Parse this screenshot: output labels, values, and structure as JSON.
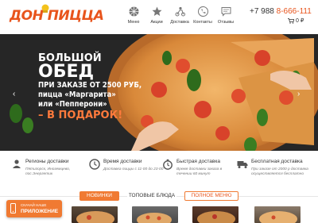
{
  "header": {
    "logo": "ДОН ПИЦЦА",
    "nav": [
      {
        "label": "Меню",
        "icon": "menu-dial-icon"
      },
      {
        "label": "Акции",
        "icon": "star-icon"
      },
      {
        "label": "Доставка",
        "icon": "delivery-icon"
      },
      {
        "label": "Контакты",
        "icon": "phone-icon"
      },
      {
        "label": "Отзывы",
        "icon": "chat-icon"
      }
    ],
    "phone_prefix": "+7 988 ",
    "phone_accent": "8-666-111",
    "cart_count": "0",
    "cart_currency": "₽"
  },
  "banner": {
    "line1": "БОЛЬШОЙ",
    "line2": "ОБЕД",
    "line3": "ПРИ ЗАКАЗЕ ОТ 2500 РУБ,",
    "line4": "пицца «Маргарита»",
    "line5": "или «Пепперони»",
    "line6": "– В ПОДАРОК!",
    "prev": "‹",
    "next": "›"
  },
  "features": [
    {
      "title": "Регионы доставки",
      "text": "Пятигорск, Иноземцево, пос.Энергетик",
      "icon": "person-pin-icon"
    },
    {
      "title": "Время доставки",
      "text": "Доставка пиццы с 11-00 до 23-00",
      "icon": "clock-icon"
    },
    {
      "title": "Быстрая доставка",
      "text": "Время доставки заказа в течении 60 минут",
      "icon": "stopwatch-icon"
    },
    {
      "title": "Бесплатная доставка",
      "text": "При заказе от 2000 р доставка осуществляется бесплатно",
      "icon": "truck-icon"
    }
  ],
  "tabs": {
    "new": "НОВИНКИ",
    "top": "ТОПОВЫЕ БЛЮДА",
    "menu": "ПОЛНОЕ МЕНЮ"
  },
  "app": {
    "top": "СКАЧАЙ НАШЕ",
    "bottom": "ПРИЛОЖЕНИЕ"
  },
  "colors": {
    "accent": "#e8541c",
    "orange": "#f07a32",
    "dark": "#2a2a2a"
  }
}
